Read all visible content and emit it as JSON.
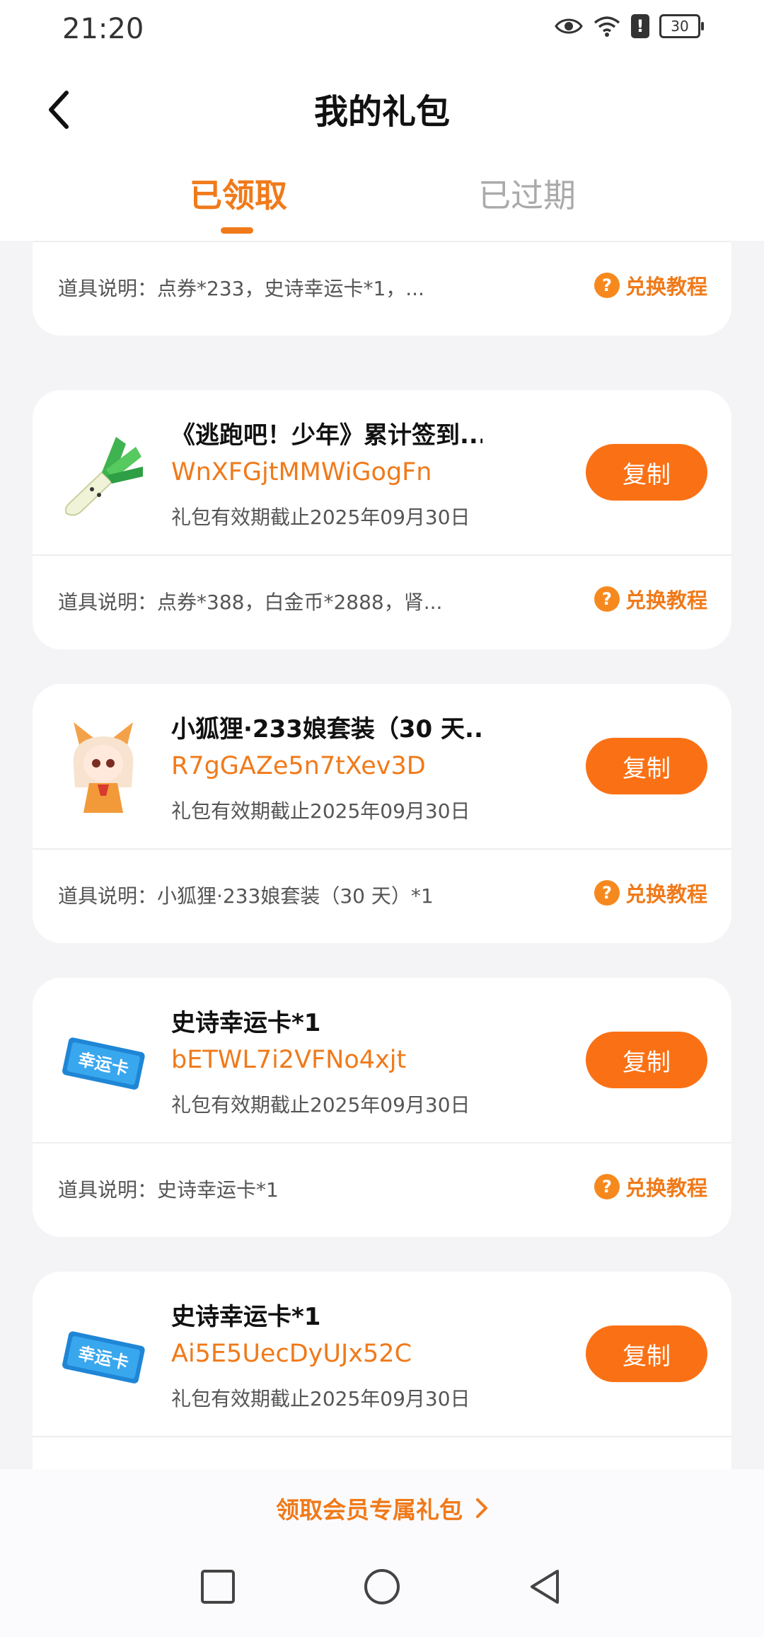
{
  "status_bar": {
    "time": "21:20",
    "battery": "30"
  },
  "header": {
    "title": "我的礼包"
  },
  "tabs": {
    "received": "已领取",
    "expired": "已过期"
  },
  "tutorial_label": "兑换教程",
  "copy_label": "复制",
  "first_card": {
    "description": "道具说明：点券*233，史诗幸运卡*1，..."
  },
  "gifts": [
    {
      "icon": "green-onion-icon",
      "title": "《逃跑吧！少年》累计签到...",
      "code": "WnXFGjtMMWiGogFn",
      "expire": "礼包有效期截止2025年09月30日",
      "description": "道具说明：点券*388，白金币*2888，肾..."
    },
    {
      "icon": "fox-girl-avatar-icon",
      "title": "小狐狸·233娘套装（30 天...",
      "code": "R7gGAZe5n7tXev3D",
      "expire": "礼包有效期截止2025年09月30日",
      "description": "道具说明：小狐狸·233娘套装（30 天）*1"
    },
    {
      "icon": "lucky-card-icon",
      "title": "史诗幸运卡*1",
      "code": "bETWL7i2VFNo4xjt",
      "expire": "礼包有效期截止2025年09月30日",
      "description": "道具说明：史诗幸运卡*1"
    },
    {
      "icon": "lucky-card-icon",
      "title": "史诗幸运卡*1",
      "code": "Ai5E5UecDyUJx52C",
      "expire": "礼包有效期截止2025年09月30日",
      "description": ""
    }
  ],
  "lucky_card_text": "幸运卡",
  "footer": {
    "member_link": "领取会员专属礼包"
  },
  "colors": {
    "accent": "#f07a1a",
    "button": "#fa7115",
    "background": "#f4f4f6"
  }
}
